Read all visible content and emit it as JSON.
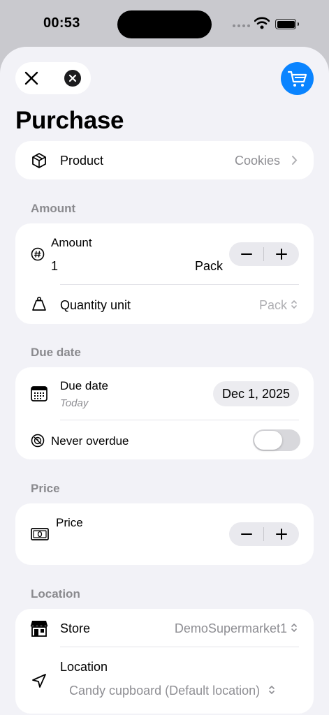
{
  "status_bar": {
    "time": "00:53"
  },
  "header": {
    "title": "Purchase"
  },
  "product_row": {
    "label": "Product",
    "value": "Cookies"
  },
  "amount_section": {
    "header": "Amount",
    "amount_label": "Amount",
    "amount_value": "1",
    "amount_unit": "Pack",
    "quantity_unit_label": "Quantity unit",
    "quantity_unit_value": "Pack"
  },
  "due_date_section": {
    "header": "Due date",
    "due_date_label": "Due date",
    "due_date_sub": "Today",
    "due_date_value": "Dec 1, 2025",
    "never_overdue_label": "Never overdue",
    "never_overdue_on": false
  },
  "price_section": {
    "header": "Price",
    "price_label": "Price"
  },
  "location_section": {
    "header": "Location",
    "store_label": "Store",
    "store_value": "DemoSupermarket1",
    "location_label": "Location",
    "location_value": "Candy cupboard (Default location)"
  },
  "icons": {
    "close": "close-icon",
    "clear": "clear-circle-icon",
    "cart": "cart-icon",
    "product": "box-icon",
    "amount": "number-icon",
    "quantity_unit": "scale-icon",
    "due_date": "calendar-icon",
    "never_overdue": "no-clock-icon",
    "price": "banknote-icon",
    "store": "storefront-icon",
    "location": "location-arrow-icon",
    "disclosure": "chevron-right-icon",
    "updown": "chevron-updown-icon"
  },
  "colors": {
    "accent": "#0a84ff",
    "background": "#f2f2f7",
    "secondary_text": "#8e8e93",
    "section_header": "#8a8a8e"
  }
}
